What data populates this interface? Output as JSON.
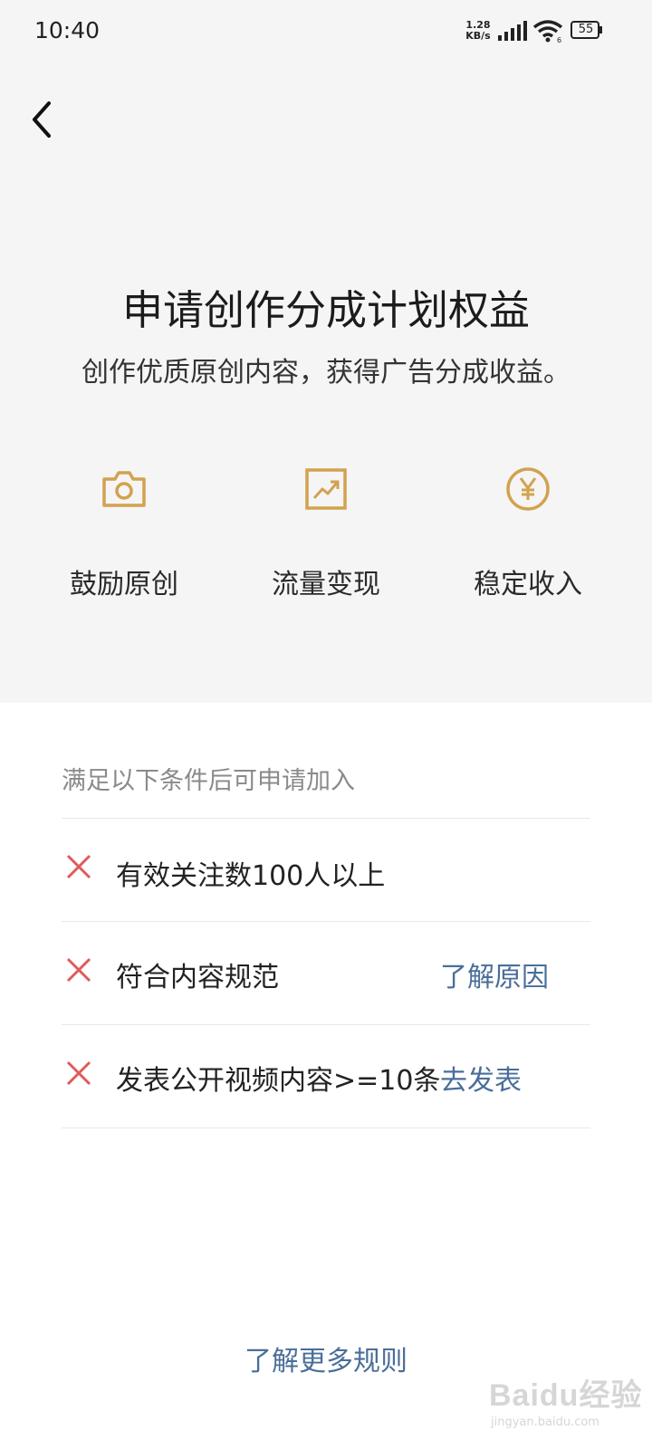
{
  "status_bar": {
    "time": "10:40",
    "net_speed_value": "1.28",
    "net_speed_unit": "KB/s",
    "battery": "55"
  },
  "header": {
    "title": "申请创作分成计划权益",
    "subtitle": "创作优质原创内容，获得广告分成收益。"
  },
  "features": [
    {
      "icon": "camera-icon",
      "label": "鼓励原创"
    },
    {
      "icon": "trend-chart-icon",
      "label": "流量变现"
    },
    {
      "icon": "yen-coin-icon",
      "label": "稳定收入"
    }
  ],
  "conditions": {
    "heading": "满足以下条件后可申请加入",
    "items": [
      {
        "status": "unmet",
        "text": "有效关注数100人以上",
        "action": ""
      },
      {
        "status": "unmet",
        "text": "符合内容规范",
        "action": "了解原因"
      },
      {
        "status": "unmet",
        "text": "发表公开视频内容>=10条",
        "action": "去发表"
      }
    ]
  },
  "footer": {
    "more_rules": "了解更多规则"
  },
  "watermark": {
    "brand": "Baidu经验",
    "url": "jingyan.baidu.com"
  },
  "colors": {
    "accent_gold": "#d2a24f",
    "link_blue": "#4a6e99",
    "error_red": "#e05a5a",
    "header_bg": "#f5f5f5"
  }
}
